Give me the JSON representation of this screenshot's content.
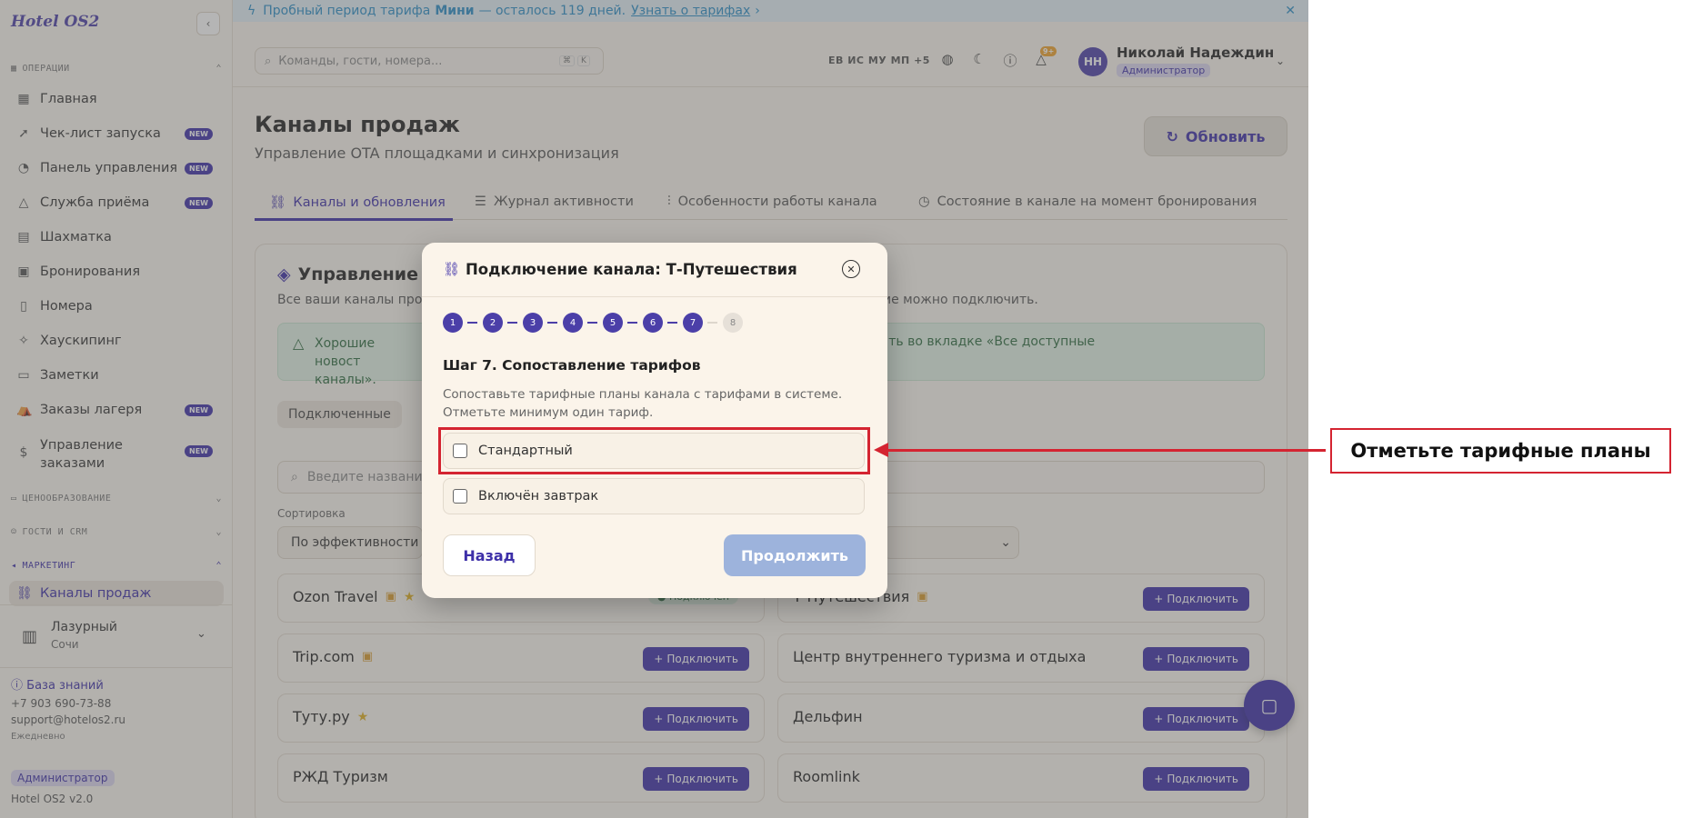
{
  "sidebar": {
    "logo": "Hotel OS2",
    "collapse_icon": "chevron-left-icon",
    "sections": {
      "operations": "ОПЕРАЦИИ",
      "pricing": "ЦЕНООБРАЗОВАНИЕ",
      "guests": "ГОСТИ И CRM",
      "marketing": "МАРКЕТИНГ"
    },
    "items": [
      {
        "label": "Главная",
        "icon": "grid-icon",
        "badge": ""
      },
      {
        "label": "Чек-лист запуска",
        "icon": "rocket-icon",
        "badge": "NEW"
      },
      {
        "label": "Панель управления",
        "icon": "gauge-icon",
        "badge": "NEW"
      },
      {
        "label": "Служба приёма",
        "icon": "bell-icon",
        "badge": "NEW"
      },
      {
        "label": "Шахматка",
        "icon": "table-icon",
        "badge": ""
      },
      {
        "label": "Бронирования",
        "icon": "calendar-icon",
        "badge": ""
      },
      {
        "label": "Номера",
        "icon": "door-icon",
        "badge": ""
      },
      {
        "label": "Хаускипинг",
        "icon": "sparkle-icon",
        "badge": ""
      },
      {
        "label": "Заметки",
        "icon": "note-icon",
        "badge": ""
      },
      {
        "label": "Заказы лагеря",
        "icon": "tent-icon",
        "badge": "NEW"
      },
      {
        "label": "Управление заказами",
        "icon": "dollar-icon",
        "badge": "NEW"
      }
    ],
    "active_item": "Каналы продаж",
    "hotel_name": "Лазурный",
    "hotel_city": "Сочи",
    "kb_link": "База знаний",
    "phone": "+7 903 690-73-88",
    "email": "support@hotelos2.ru",
    "hours": "Ежедневно",
    "role": "Администратор",
    "version": "Hotel OS2 v2.0"
  },
  "banner": {
    "text_pre": "Пробный период тарифа",
    "plan": "Мини",
    "text_post": "— осталось 119 дней.",
    "link": "Узнать о тарифах",
    "link_arrow": "›"
  },
  "header": {
    "search_placeholder": "Команды, гости, номера...",
    "kbd1": "⌘",
    "kbd2": "K",
    "langs": "ЕВ ИС МУ МП +5",
    "notif_count": "9+",
    "user_initials": "НН",
    "user_name": "Николай Надеждин",
    "user_role": "Администратор"
  },
  "main": {
    "title": "Каналы продаж",
    "subtitle": "Управление OTA площадками и синхронизация",
    "refresh": "Обновить",
    "tabs": [
      {
        "label": "Каналы и обновления",
        "icon": "link-icon"
      },
      {
        "label": "Журнал активности",
        "icon": "list-icon"
      },
      {
        "label": "Особенности работы канала",
        "icon": "sliders-icon"
      },
      {
        "label": "Состояние в канале на момент бронирования",
        "icon": "history-icon"
      }
    ],
    "card_title": "Управление ка",
    "card_sub_left": "Все ваши каналы прод",
    "card_sub_right": "ие можно подключить.",
    "alert_left": "Хорошие новост каналы».",
    "alert_right": "го можно подключить во вкладке «Все доступные",
    "pill_tab": "Подключенные",
    "filter_placeholder": "Введите названи",
    "sort_label": "Сортировка",
    "sort_value": "По эффективности",
    "connect_label": "Подключить",
    "connected_label": "Подключен",
    "channels": [
      {
        "name": "Ozon Travel",
        "cal": true,
        "star": true,
        "state": "connected"
      },
      {
        "name": "Т-Путешествия",
        "cal": true,
        "star": false,
        "state": "connect"
      },
      {
        "name": "Trip.com",
        "cal": true,
        "star": false,
        "state": "connect"
      },
      {
        "name": "Центр внутреннего туризма и отдыха",
        "cal": false,
        "star": false,
        "state": "connect"
      },
      {
        "name": "Туту.ру",
        "cal": false,
        "star": true,
        "state": "connect"
      },
      {
        "name": "Дельфин",
        "cal": false,
        "star": false,
        "state": "connect"
      },
      {
        "name": "РЖД Туризм",
        "cal": false,
        "star": false,
        "state": "connect"
      },
      {
        "name": "Roomlink",
        "cal": false,
        "star": false,
        "state": "connect"
      }
    ]
  },
  "modal": {
    "title": "Подключение канала: Т-Путешествия",
    "steps": [
      "1",
      "2",
      "3",
      "4",
      "5",
      "6",
      "7",
      "8"
    ],
    "current_step": 7,
    "step_title": "Шаг 7. Сопоставление тарифов",
    "step_desc": "Сопоставьте тарифные планы канала с тарифами в системе. Отметьте минимум один тариф.",
    "rates": [
      "Стандартный",
      "Включён завтрак"
    ],
    "back": "Назад",
    "continue": "Продолжить"
  },
  "annotation": {
    "label": "Отметьте тарифные планы",
    "color": "#d42431"
  },
  "colors": {
    "accent": "#3d2fa8",
    "banner": "#2a8fc8",
    "annotation": "#d42431"
  }
}
